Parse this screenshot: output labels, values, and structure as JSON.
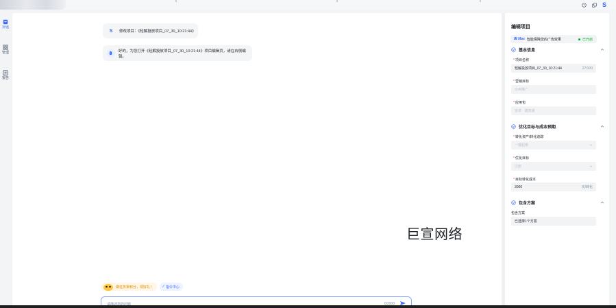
{
  "topbar": {
    "icons": [
      "help-icon",
      "copy-icon"
    ],
    "avatar_letter": "S"
  },
  "leftnav": {
    "items": [
      {
        "label": "对话",
        "icon": "chat-icon",
        "active": true
      },
      {
        "label": "管理",
        "icon": "grid-icon",
        "active": false
      },
      {
        "label": "报告",
        "icon": "report-icon",
        "active": false
      }
    ]
  },
  "chat": {
    "messages": [
      {
        "role": "user",
        "avatar": "S",
        "text": "修改项目：《轻解投放项目_07_30_10:21:44》"
      },
      {
        "role": "assistant",
        "avatar_icon": "bot-icon",
        "text": "好的，为您打开《轻解投放项目_07_30_10:21:44》项目编辑页，请在右侧编辑。"
      }
    ],
    "watermark": "巨宣网络",
    "chips": {
      "help": "做任务累积分，领好礼！",
      "command": "指令中心"
    },
    "input": {
      "placeholder": "请描述您的问题",
      "counter": "0/2000"
    }
  },
  "panel": {
    "title": "编辑项目",
    "max_banner": {
      "logo": "Max",
      "text": "智能保障您的广告效果",
      "status": "已开启",
      "status_color": "#00b42a"
    },
    "sections": {
      "basic": {
        "title": "基本信息",
        "project_name_label": "项目名称",
        "project_name_value": "轻解投放项目_07_30_10:21:44",
        "project_name_count": "27/100",
        "marketing_goal_label": "营销目标",
        "marketing_goal_value": "应用推广",
        "app_pkg_label": "应用包",
        "app_pkg_value": "安卓 · 建筑通"
      },
      "optimize": {
        "title": "优化目标与成本预期",
        "conversion_label": "转化资产/转化追踪",
        "conversion_value": "一键起量",
        "target_label": "优化目标",
        "target_value": "注册",
        "cost_label": "目标转化成本",
        "cost_value": "3000",
        "cost_unit": "元/转化"
      },
      "plans": {
        "title": "包含方案",
        "label": "包含方案",
        "value": "已选择1个方案"
      }
    }
  },
  "colors": {
    "accent": "#3d6bf5",
    "required": "#f53f3f",
    "success": "#00b42a"
  }
}
